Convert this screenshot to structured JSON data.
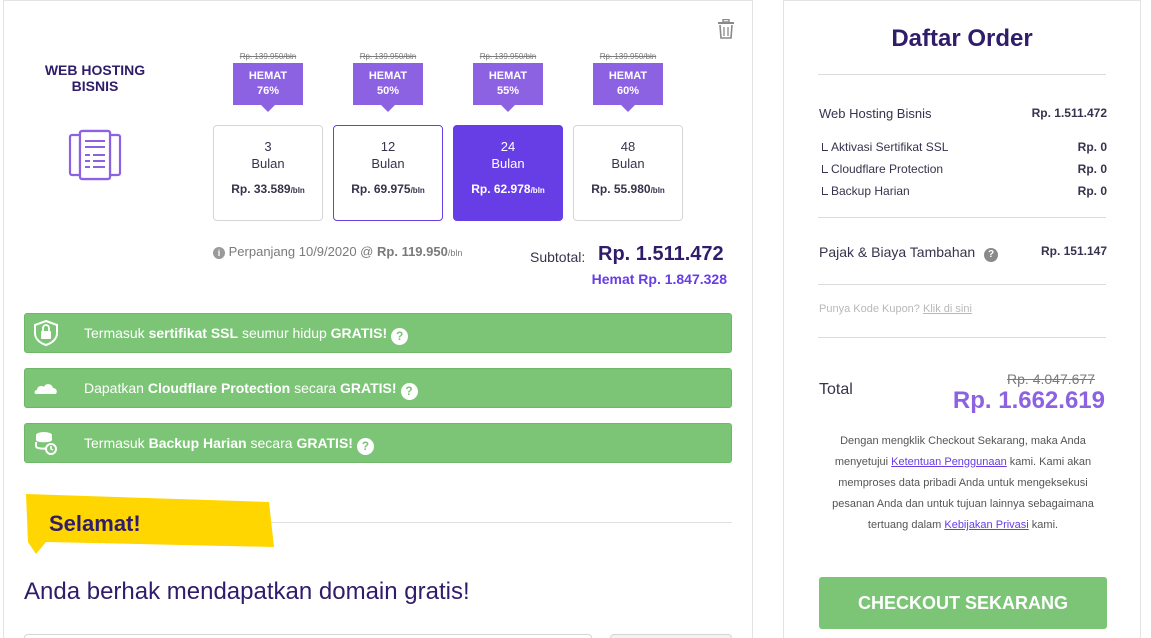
{
  "product": {
    "title": "WEB HOSTING BISNIS",
    "icon": "server-icon"
  },
  "plans": [
    {
      "months": "3",
      "unit": "Bulan",
      "price": "Rp. 33.589",
      "per": "/bln",
      "old_price": "Rp. 139.950/bln",
      "badge_label": "HEMAT",
      "badge_pct": "76%",
      "state": "default"
    },
    {
      "months": "12",
      "unit": "Bulan",
      "price": "Rp. 69.975",
      "per": "/bln",
      "old_price": "Rp. 139.950/bln",
      "badge_label": "HEMAT",
      "badge_pct": "50%",
      "state": "outlined"
    },
    {
      "months": "24",
      "unit": "Bulan",
      "price": "Rp. 62.978",
      "per": "/bln",
      "old_price": "Rp. 139.950/bln",
      "badge_label": "HEMAT",
      "badge_pct": "55%",
      "state": "selected"
    },
    {
      "months": "48",
      "unit": "Bulan",
      "price": "Rp. 55.980",
      "per": "/bln",
      "old_price": "Rp. 139.950/bln",
      "badge_label": "HEMAT",
      "badge_pct": "60%",
      "state": "default"
    }
  ],
  "renewal": {
    "prefix": "Perpanjang 10/9/2020 @",
    "price": "Rp. 119.950",
    "per": "/bln"
  },
  "subtotal": {
    "label": "Subtotal:",
    "value": "Rp. 1.511.472",
    "savings": "Hemat Rp. 1.847.328"
  },
  "features": [
    {
      "icon": "ssl-shield-icon",
      "pre": "Termasuk ",
      "bold": "sertifikat SSL",
      "mid": " seumur hidup ",
      "bold2": "GRATIS!"
    },
    {
      "icon": "cloud-icon",
      "pre": "Dapatkan ",
      "bold": "Cloudflare Protection",
      "mid": " secara ",
      "bold2": "GRATIS!"
    },
    {
      "icon": "backup-database-icon",
      "pre": "Termasuk ",
      "bold": "Backup Harian",
      "mid": " secara ",
      "bold2": "GRATIS!"
    }
  ],
  "promo": {
    "sticker": "Selamat!",
    "heading": "Anda berhak mendapatkan domain gratis!"
  },
  "order": {
    "title": "Daftar Order",
    "main_item": {
      "label": "Web Hosting Bisnis",
      "value": "Rp. 1.511.472"
    },
    "sub_items": [
      {
        "label": "Aktivasi Sertifikat SSL",
        "value": "Rp. 0"
      },
      {
        "label": "Cloudflare Protection",
        "value": "Rp. 0"
      },
      {
        "label": "Backup Harian",
        "value": "Rp. 0"
      }
    ],
    "tax": {
      "label": "Pajak & Biaya Tambahan",
      "value": "Rp. 151.147"
    },
    "coupon": {
      "text": "Punya Kode Kupon?",
      "link": "Klik di sini"
    },
    "total": {
      "label": "Total",
      "old": "Rp. 4.047.677",
      "new": "Rp. 1.662.619"
    },
    "disclaimer": {
      "p1": "Dengan mengklik Checkout Sekarang, maka Anda menyetujui ",
      "link1": "Ketentuan Penggunaan",
      "p2": " kami. Kami akan memproses data pribadi Anda untuk mengeksekusi pesanan Anda dan untuk tujuan lainnya sebagaimana tertuang dalam ",
      "link2": "Kebijakan Privasi",
      "p3": " kami."
    },
    "checkout_label": "CHECKOUT SEKARANG"
  },
  "colors": {
    "primary": "#673de6",
    "badge": "#8c62e3",
    "green": "#7cc576",
    "sticker": "#ffd600",
    "text": "#2f1c6a"
  }
}
